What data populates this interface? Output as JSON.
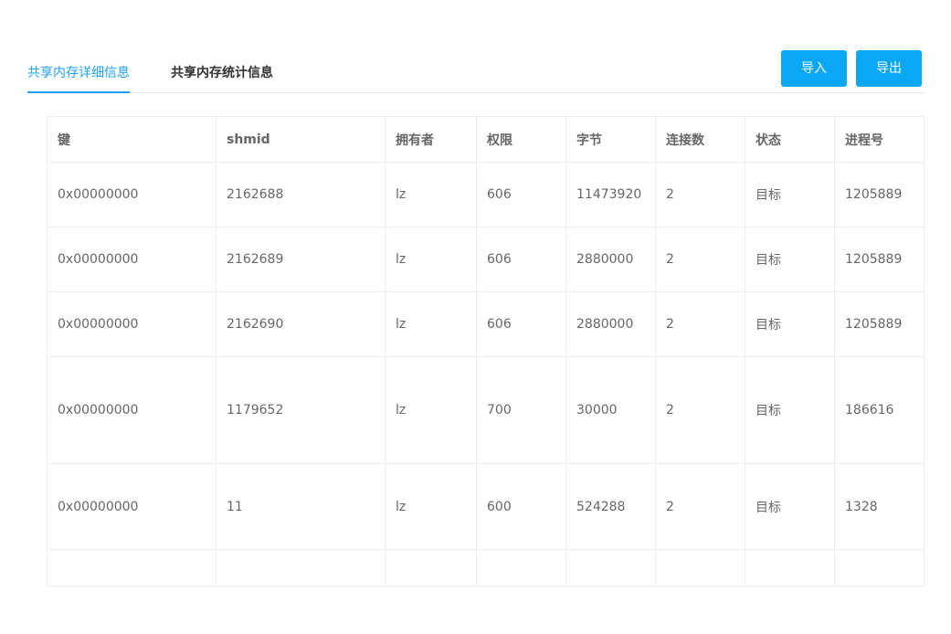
{
  "tabs": [
    {
      "label": "共享内存详细信息",
      "active": true
    },
    {
      "label": "共享内存统计信息",
      "active": false
    }
  ],
  "toolbar": {
    "import_label": "导入",
    "export_label": "导出"
  },
  "colors": {
    "accent": "#1e9fff",
    "button": "#0aa7f5"
  },
  "table": {
    "columns": [
      "键",
      "shmid",
      "拥有者",
      "权限",
      "字节",
      "连接数",
      "状态",
      "进程号"
    ],
    "rows": [
      [
        "0x00000000",
        "2162688",
        "lz",
        "606",
        "11473920",
        "2",
        "目标",
        "1205889"
      ],
      [
        "0x00000000",
        "2162689",
        "lz",
        "606",
        "2880000",
        "2",
        "目标",
        "1205889"
      ],
      [
        "0x00000000",
        "2162690",
        "lz",
        "606",
        "2880000",
        "2",
        "目标",
        "1205889"
      ],
      [
        "0x00000000",
        "1179652",
        "lz",
        "700",
        "30000",
        "2",
        "目标",
        "186616"
      ],
      [
        "0x00000000",
        "11",
        "lz",
        "600",
        "524288",
        "2",
        "目标",
        "1328"
      ],
      [
        "",
        "",
        "",
        "",
        "",
        "",
        "",
        ""
      ]
    ]
  }
}
